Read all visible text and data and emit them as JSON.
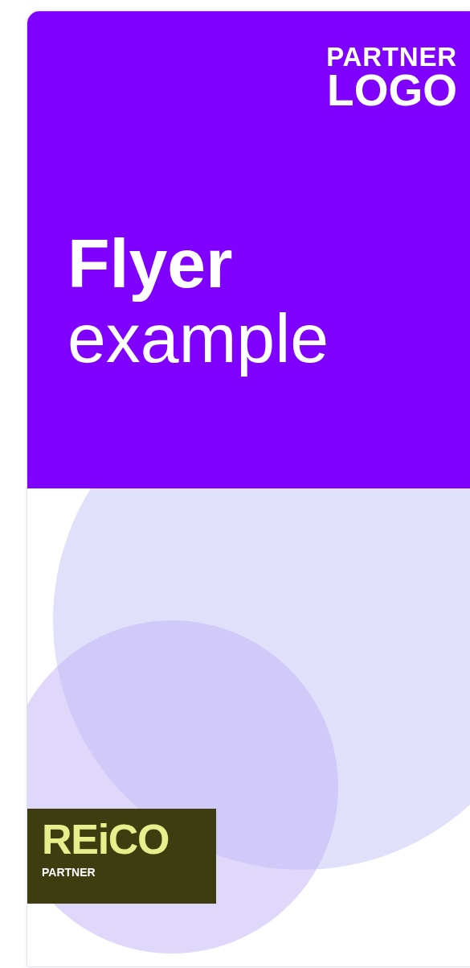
{
  "partner_logo": {
    "line_1": "PARTNER",
    "line_2": "LOGO"
  },
  "headline": {
    "title": "Flyer",
    "subtitle": "example"
  },
  "badge": {
    "brand": "REiCO",
    "label": "PARTNER"
  }
}
